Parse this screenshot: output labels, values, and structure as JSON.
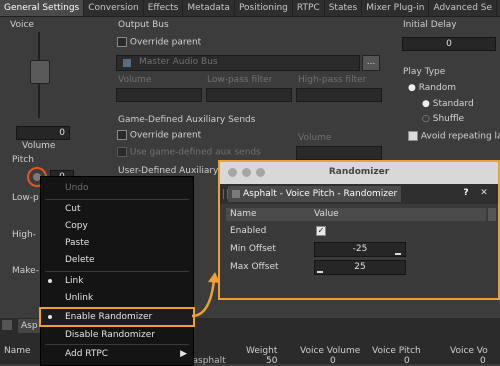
{
  "tabs": [
    "General Settings",
    "Conversion",
    "Effects",
    "Metadata",
    "Positioning",
    "RTPC",
    "States",
    "Mixer Plug-in",
    "Advanced Se"
  ],
  "voice": {
    "title": "Voice",
    "volume_label": "Volume",
    "volume_value": "0",
    "pitch_label": "Pitch",
    "pitch_value": "0",
    "lowpass_label": "Low-p",
    "highpass_label": "High-",
    "makeup_label": "Make-"
  },
  "output_bus": {
    "title": "Output Bus",
    "override_label": "Override parent",
    "bus_name": "Master Audio Bus",
    "browse_label": "...",
    "volume": "Volume",
    "lowpass": "Low-pass filter",
    "highpass": "High-pass filter"
  },
  "aux_sends": {
    "title": "Game-Defined Auxiliary Sends",
    "override_label": "Override parent",
    "use_label": "Use game-defined aux sends",
    "volume": "Volume",
    "user_defined": "User-Defined Auxiliary S"
  },
  "initial_delay": {
    "title": "Initial Delay",
    "value": "0"
  },
  "play_type": {
    "title": "Play Type",
    "random": "Random",
    "standard": "Standard",
    "shuffle": "Shuffle",
    "avoid": "Avoid repeating las"
  },
  "menu": {
    "undo": "Undo",
    "cut": "Cut",
    "copy": "Copy",
    "paste": "Paste",
    "delete": "Delete",
    "link": "Link",
    "unlink": "Unlink",
    "enable_randomizer": "Enable Randomizer",
    "disable_randomizer": "Disable Randomizer",
    "add_rtpc": "Add RTPC"
  },
  "randomizer": {
    "window_title": "Randomizer",
    "tab_title": "Asphalt - Voice Pitch - Randomizer",
    "col_name": "Name",
    "col_value": "Value",
    "rows": [
      {
        "name": "Enabled"
      },
      {
        "name": "Min Offset",
        "value": "-25"
      },
      {
        "name": "Max Offset",
        "value": "25"
      }
    ],
    "help_label": "?",
    "close_label": "✕"
  },
  "bottom": {
    "tab": "Asp",
    "weight": "Weight",
    "weight_value": "50",
    "voice_volume": "Voice Volume",
    "voice_pitch": "Voice Pitch",
    "voice_vol2": "Voice Vo",
    "name_partial": "...cmp_asphalt",
    "v1": "0",
    "v2": "0",
    "v3": "0"
  },
  "colors": {
    "accent": "#f0a030"
  }
}
